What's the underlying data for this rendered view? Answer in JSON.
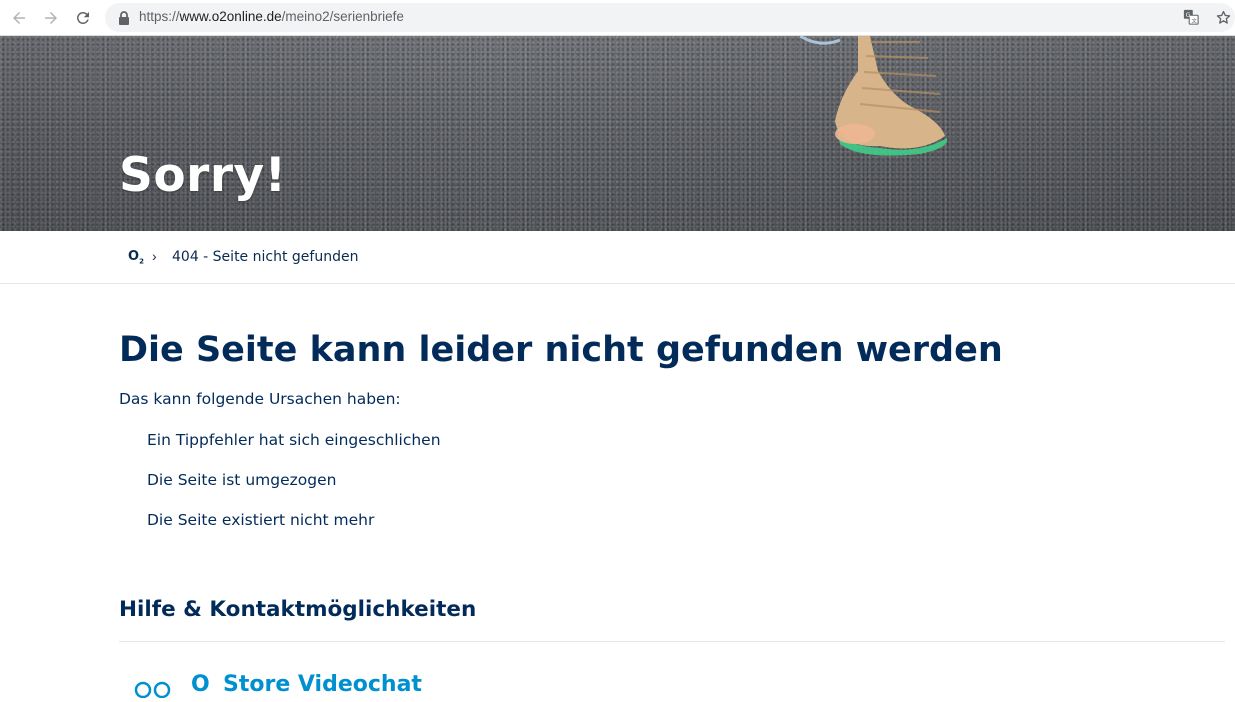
{
  "browser": {
    "url_scheme": "https://",
    "url_host": "www.o2online.de",
    "url_path": "/meino2/serienbriefe"
  },
  "hero": {
    "title": "Sorry!"
  },
  "breadcrumb": {
    "home": "O",
    "home_sub": "2",
    "separator": "›",
    "current": "404 - Seite nicht gefunden"
  },
  "main": {
    "title": "Die Seite kann leider nicht gefunden werden",
    "intro": "Das kann folgende Ursachen haben:",
    "reasons": [
      "Ein Tippfehler hat sich eingeschlichen",
      "Die Seite ist umgezogen",
      "Die Seite existiert nicht mehr"
    ]
  },
  "help": {
    "title": "Hilfe & Kontaktmöglichkeiten",
    "videochat_brand": "O",
    "videochat_label": "Store Videochat"
  },
  "colors": {
    "heading": "#032b5a",
    "link": "#0090d0"
  },
  "icons": [
    "back-arrow-icon",
    "forward-arrow-icon",
    "reload-icon",
    "lock-icon",
    "translate-icon",
    "star-icon",
    "videochat-icon"
  ]
}
